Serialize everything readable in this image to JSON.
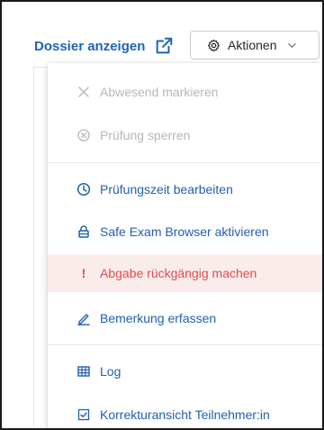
{
  "header": {
    "dossier_link_label": "Dossier anzeigen",
    "actions_button_label": "Aktionen"
  },
  "menu": {
    "items": [
      {
        "label": "Abwesend markieren",
        "icon": "close-x-icon",
        "state": "disabled"
      },
      {
        "label": "Prüfung sperren",
        "icon": "circle-x-icon",
        "state": "disabled"
      },
      {
        "label": "Prüfungszeit bearbeiten",
        "icon": "clock-icon",
        "state": "normal"
      },
      {
        "label": "Safe Exam Browser aktivieren",
        "icon": "lock-icon",
        "state": "normal"
      },
      {
        "label": "Abgabe rückgängig machen",
        "icon": "exclamation-icon",
        "state": "danger"
      },
      {
        "label": "Bemerkung erfassen",
        "icon": "pencil-icon",
        "state": "normal"
      },
      {
        "label": "Log",
        "icon": "table-icon",
        "state": "normal"
      },
      {
        "label": "Korrekturansicht Teilnehmer:in",
        "icon": "checkbox-icon",
        "state": "normal"
      }
    ]
  },
  "colors": {
    "link_blue": "#1f63b6",
    "menu_blue": "#1f5fb3",
    "disabled_gray": "#b3b7bd",
    "danger_red": "#e24b4b",
    "danger_bg": "#fbecec"
  }
}
